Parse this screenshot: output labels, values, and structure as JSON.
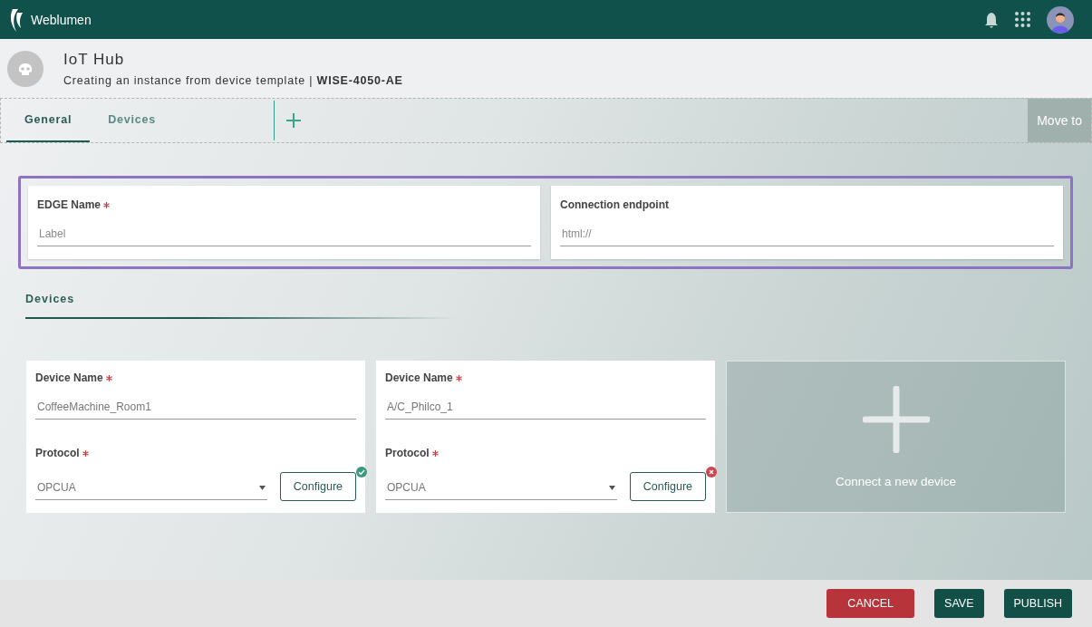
{
  "app": {
    "name": "Weblumen"
  },
  "header": {
    "title": "IoT Hub",
    "subtitle": "Creating an instance from device template | **WISE-4050-AE**"
  },
  "tabs": [
    {
      "label": "General",
      "selected": true
    },
    {
      "label": "Devices",
      "selected": false
    }
  ],
  "move_to": "Move to",
  "edge_fields": [
    {
      "label": "EDGE Name",
      "required": true,
      "placeholder": "Label"
    },
    {
      "label": "Connection endpoint",
      "required": false,
      "placeholder": "html://"
    }
  ],
  "devices_heading": "Devices",
  "devices": [
    {
      "name_label": "Device Name",
      "name_value": "CoffeeMachine_Room1",
      "protocol_label": "Protocol",
      "protocol_value": "OPCUA",
      "configure": "Configure",
      "configured": true
    },
    {
      "name_label": "Device Name",
      "name_value": "A/C_Philco_1",
      "protocol_label": "Protocol",
      "protocol_value": "OPCUA",
      "configure": "Configure",
      "configured": false
    }
  ],
  "add_device": "Connect a new device",
  "footer_buttons": [
    {
      "label": "CANCEL",
      "kind": "danger"
    },
    {
      "label": "SAVE",
      "kind": "primary"
    },
    {
      "label": "PUBLISH",
      "kind": "primary"
    }
  ]
}
